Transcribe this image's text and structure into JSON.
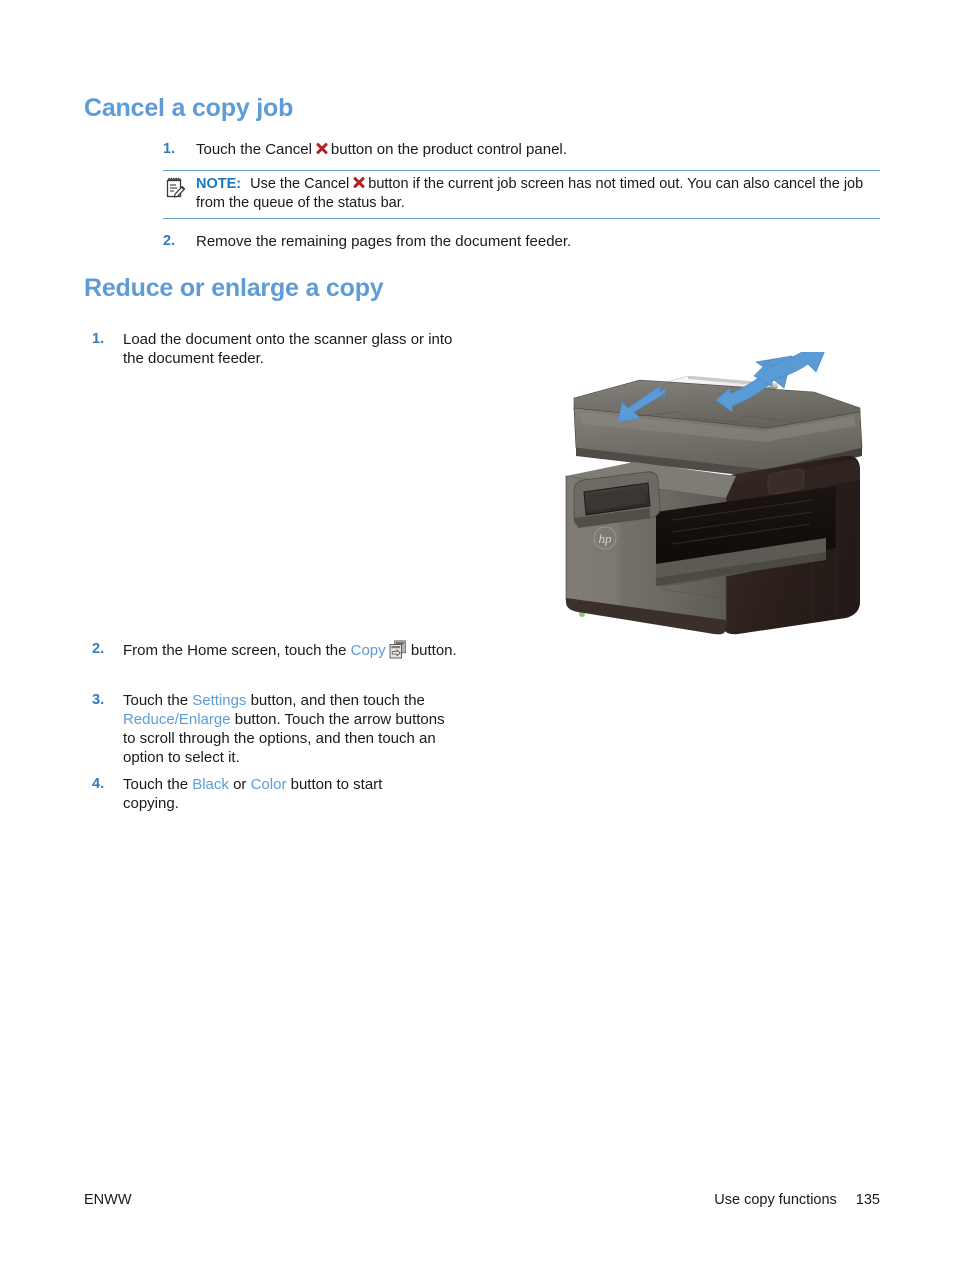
{
  "page": {
    "sections": [
      {
        "heading": "Cancel a copy job",
        "steps": [
          {
            "number": "1.",
            "text_before": "Touch the Cancel",
            "icon": "cancel-x-icon",
            "text_after": "button on the product control panel."
          }
        ]
      },
      {
        "heading": "Reduce or enlarge a copy"
      }
    ]
  },
  "note": {
    "label": "NOTE:",
    "icon": "note-pencil-icon",
    "text_before": "Use the Cancel",
    "inline_icon": "cancel-x-icon",
    "text_after": "button if the current job screen has not timed out. You can also cancel the job from the queue of the status bar."
  },
  "step_cancel_2": {
    "number": "2.",
    "text": "Remove the remaining pages from the document feeder."
  },
  "reduce_steps": {
    "step1": {
      "number": "1.",
      "text": "Load the document onto the scanner glass or into the document feeder."
    },
    "step2": {
      "number": "2.",
      "text_before": "From the Home screen, touch the",
      "ui_term": "Copy",
      "icon": "copy-button-icon",
      "text_after": "button."
    },
    "step3": {
      "number": "3.",
      "text_1": "Touch the",
      "ui_term_1": "Settings",
      "text_2": "button, and then touch the",
      "ui_term_2": "Reduce/Enlarge",
      "text_3": "button. Touch the arrow buttons to scroll through the options, and then touch an option to select it."
    },
    "step4": {
      "number": "4.",
      "text_1": "Touch the",
      "ui_term_1": "Black",
      "text_2": "or",
      "ui_term_2": "Color",
      "text_3": "button to start copying."
    }
  },
  "illustration": {
    "name": "hp-multifunction-printer",
    "description": "HP multifunction printer with document feeder, blue load arrows, touchscreen control panel, HP logo and output tray"
  },
  "footer": {
    "left": "ENWW",
    "right_label": "Use copy functions",
    "page_number": "135"
  },
  "colors": {
    "heading_blue": "#5d9cd6",
    "step_number_blue": "#2b7dc4",
    "note_label_blue": "#1a7ac0",
    "note_rule": "#6fa8cf",
    "cancel_red": "#b22222",
    "body_text": "#1a1a1a"
  }
}
